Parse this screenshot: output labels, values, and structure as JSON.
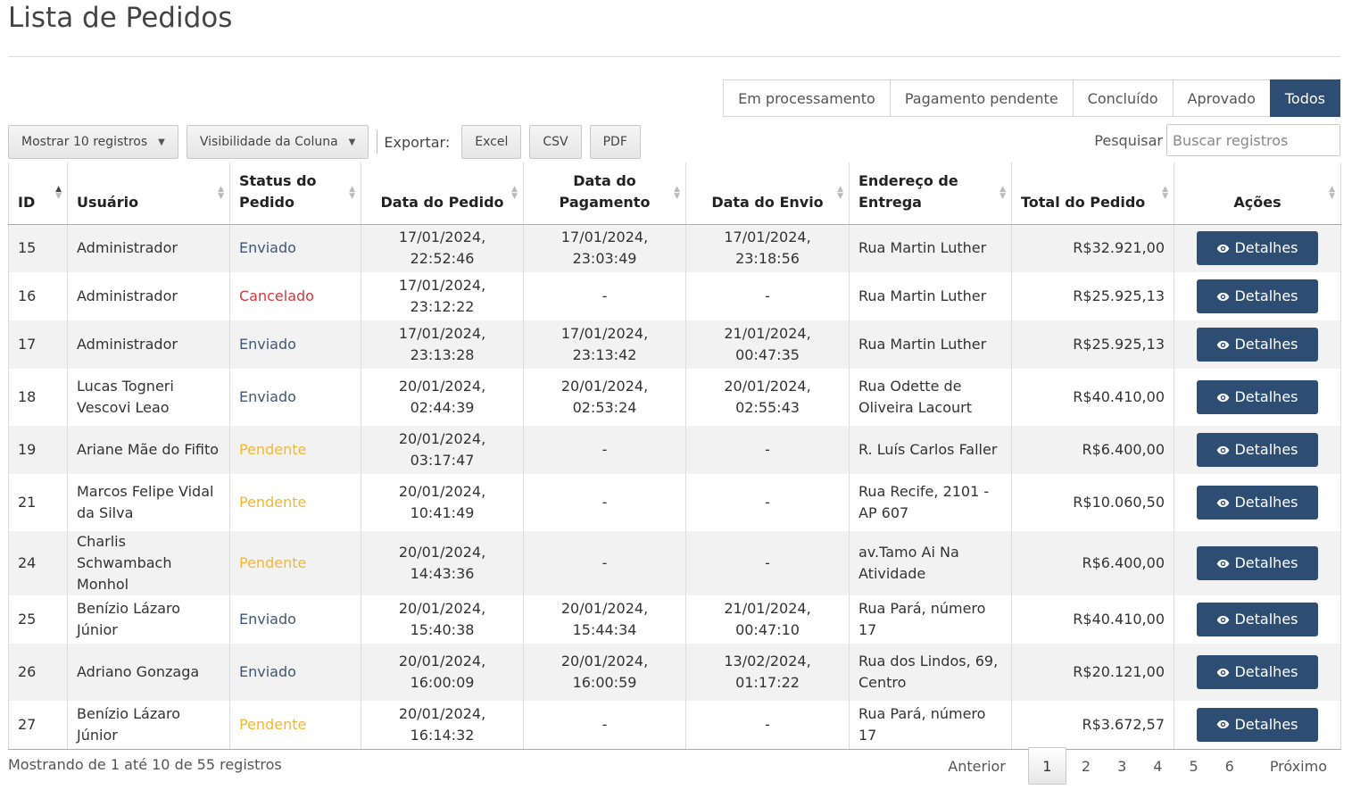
{
  "page": {
    "title": "Lista de Pedidos"
  },
  "filters": {
    "tabs": [
      {
        "label": "Em processamento"
      },
      {
        "label": "Pagamento pendente"
      },
      {
        "label": "Concluído"
      },
      {
        "label": "Aprovado"
      },
      {
        "label": "Todos",
        "active": true
      }
    ]
  },
  "toolbar": {
    "show_entries": "Mostrar 10 registros",
    "column_visibility": "Visibilidade da Coluna",
    "export_label": "Exportar:",
    "excel": "Excel",
    "csv": "CSV",
    "pdf": "PDF",
    "search_label": "Pesquisar",
    "search_placeholder": "Buscar registros",
    "caret": "▼"
  },
  "table": {
    "headers": [
      "ID",
      "Usuário",
      "Status do Pedido",
      "Data do Pedido",
      "Data do Pagamento",
      "Data do Envio",
      "Endereço de Entrega",
      "Total do Pedido",
      "Ações"
    ],
    "action_label": "Detalhes",
    "rows": [
      [
        "15",
        "Administrador",
        "Enviado",
        "17/01/2024, 22:52:46",
        "17/01/2024, 23:03:49",
        "17/01/2024, 23:18:56",
        "Rua Martin Luther",
        "R$32.921,00"
      ],
      [
        "16",
        "Administrador",
        "Cancelado",
        "17/01/2024, 23:12:22",
        "-",
        "-",
        "Rua Martin Luther",
        "R$25.925,13"
      ],
      [
        "17",
        "Administrador",
        "Enviado",
        "17/01/2024, 23:13:28",
        "17/01/2024, 23:13:42",
        "21/01/2024, 00:47:35",
        "Rua Martin Luther",
        "R$25.925,13"
      ],
      [
        "18",
        "Lucas Togneri Vescovi Leao",
        "Enviado",
        "20/01/2024, 02:44:39",
        "20/01/2024, 02:53:24",
        "20/01/2024, 02:55:43",
        "Rua Odette de Oliveira Lacourt",
        "R$40.410,00"
      ],
      [
        "19",
        "Ariane Mãe do Fifito",
        "Pendente",
        "20/01/2024, 03:17:47",
        "-",
        "-",
        "R. Luís Carlos Faller",
        "R$6.400,00"
      ],
      [
        "21",
        "Marcos Felipe Vidal da Silva",
        "Pendente",
        "20/01/2024, 10:41:49",
        "-",
        "-",
        "Rua Recife, 2101 - AP 607",
        "R$10.060,50"
      ],
      [
        "24",
        "Charlis Schwambach Monhol",
        "Pendente",
        "20/01/2024, 14:43:36",
        "-",
        "-",
        "av.Tamo Ai Na Atividade",
        "R$6.400,00"
      ],
      [
        "25",
        "Benízio Lázaro Júnior",
        "Enviado",
        "20/01/2024, 15:40:38",
        "20/01/2024, 15:44:34",
        "21/01/2024, 00:47:10",
        "Rua Pará, número 17",
        "R$40.410,00"
      ],
      [
        "26",
        "Adriano Gonzaga",
        "Enviado",
        "20/01/2024, 16:00:09",
        "20/01/2024, 16:00:59",
        "13/02/2024, 01:17:22",
        "Rua dos Lindos, 69, Centro",
        "R$20.121,00"
      ],
      [
        "27",
        "Benízio Lázaro Júnior",
        "Pendente",
        "20/01/2024, 16:14:32",
        "-",
        "-",
        "Rua Pará, número 17",
        "R$3.672,57"
      ]
    ]
  },
  "footer": {
    "info": "Mostrando de 1 até 10 de 55 registros",
    "prev": "Anterior",
    "next": "Próximo",
    "pages": [
      "1",
      "2",
      "3",
      "4",
      "5",
      "6"
    ],
    "current_page": "1"
  },
  "colors": {
    "accent": "#2d4d72",
    "status_enviado": "#3f5778",
    "status_cancelado": "#d9363e",
    "status_pendente": "#f5b72b"
  }
}
